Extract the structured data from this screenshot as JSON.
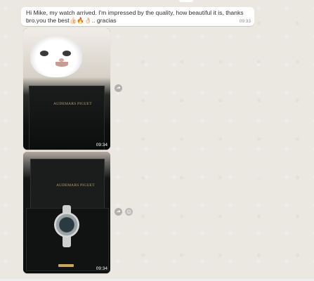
{
  "messages": [
    {
      "type": "text",
      "text": "Hi Mike, my watch arrived. I'm impressed by the quality, how beautiful it is, thanks bro.you the best👍🏻🔥👌🏻.. gracias",
      "time": "09:33"
    },
    {
      "type": "image",
      "description_icon": "watch-box-closed-with-sticker",
      "brand_text": "AUDEMARS PIGUET",
      "time": "09:34"
    },
    {
      "type": "image",
      "description_icon": "watch-box-open",
      "brand_text": "AUDEMARS PIGUET",
      "time": "09:34"
    }
  ],
  "icons": {
    "forward": "forward-icon",
    "emoji": "emoji-reaction-icon"
  },
  "colors": {
    "chat_bg": "#eae6df",
    "bubble_bg": "#ffffff",
    "text": "#303030",
    "time": "#8a8a8a"
  }
}
